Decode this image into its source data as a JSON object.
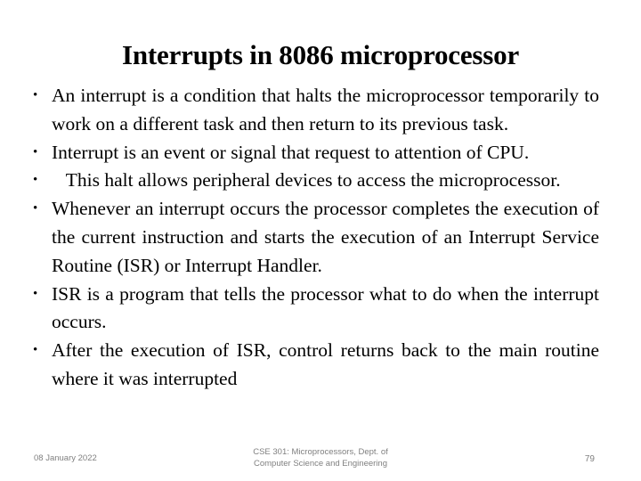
{
  "slide": {
    "title": "Interrupts in 8086 microprocessor",
    "bullets": [
      {
        "id": "bullet-definition",
        "text": "An interrupt is a condition that halts the microprocessor temporarily to work on a different task and then return to its previous task."
      },
      {
        "id": "bullet-event-signal",
        "text": "Interrupt is an event or signal that request to attention of CPU."
      },
      {
        "id": "bullet-halt-peripheral",
        "lead": "   ",
        "text": "This halt allows peripheral devices to access the microprocessor."
      },
      {
        "id": "bullet-processor-flow",
        "text": "Whenever an interrupt occurs the processor completes the execution of the current instruction and starts the execution of an Interrupt Service Routine (ISR) or Interrupt Handler."
      },
      {
        "id": "bullet-isr-program",
        "text": "ISR is a program that tells the processor what to do when the interrupt occurs."
      },
      {
        "id": "bullet-return-main",
        "text": "After the execution of ISR, control returns back to the main routine where it was interrupted"
      }
    ]
  },
  "footer": {
    "date": "08 January 2022",
    "course_line1": "CSE 301: Microprocessors, Dept. of",
    "course_line2": "Computer Science and Engineering",
    "page_number": "79"
  },
  "colors": {
    "background": "#ffffff",
    "text": "#000000",
    "footer_text": "#808080"
  }
}
